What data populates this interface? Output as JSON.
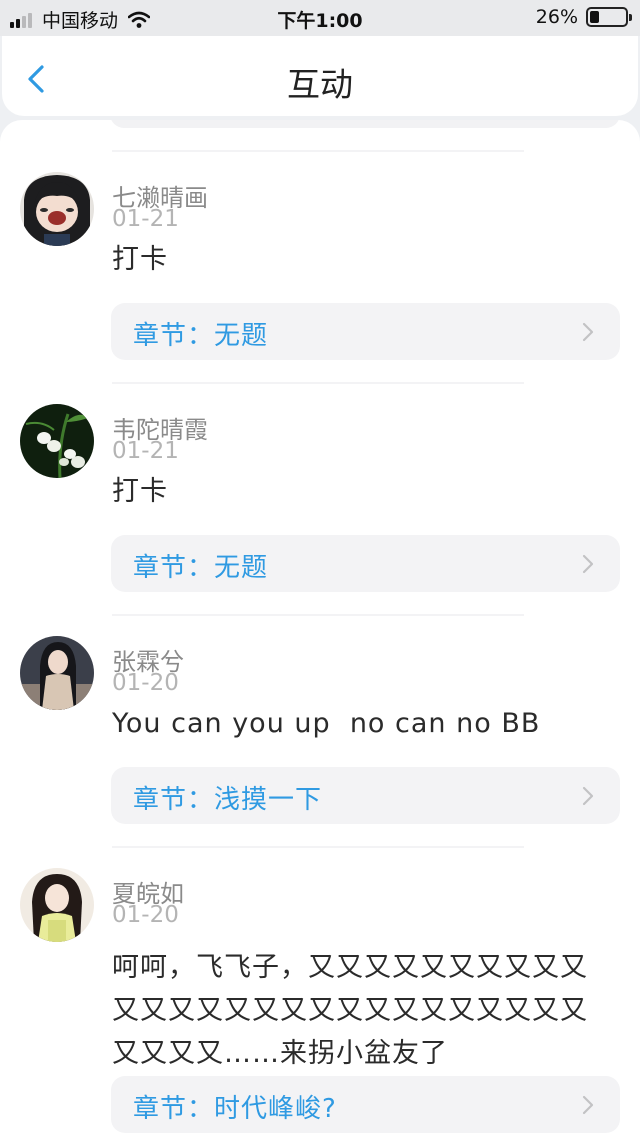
{
  "status_bar": {
    "carrier": "中国移动",
    "time": "下午1:00",
    "battery_percent": "26%",
    "battery_level": 0.26,
    "signal_bars": 4,
    "signal_bars_active": 2
  },
  "nav": {
    "title": "互动",
    "back_icon": "chevron-left-icon"
  },
  "colors": {
    "accent": "#2f9ae2",
    "username": "#8a8a8a",
    "date": "#b4b4b4",
    "card_bg": "#f3f3f5"
  },
  "comments": [
    {
      "username": "七濑晴画",
      "date": "01-21",
      "text": "打卡",
      "chapter": "章节：无题",
      "avatar": "avatar-girl-cartoon"
    },
    {
      "username": "韦陀晴霞",
      "date": "01-21",
      "text": "打卡",
      "chapter": "章节：无题",
      "avatar": "avatar-lily-of-the-valley"
    },
    {
      "username": "张霖兮",
      "date": "01-20",
      "text": "You can you up  no can no BB",
      "chapter": "章节：浅摸一下",
      "avatar": "avatar-woman-dark"
    },
    {
      "username": "夏皖如",
      "date": "01-20",
      "text": "呵呵，飞飞子，又又又又又又又又又又又又又又又又又又又又又又又又又又又又又又又……来拐小盆友了",
      "chapter": "章节：时代峰峻?",
      "avatar": "avatar-girl-yellow"
    }
  ]
}
